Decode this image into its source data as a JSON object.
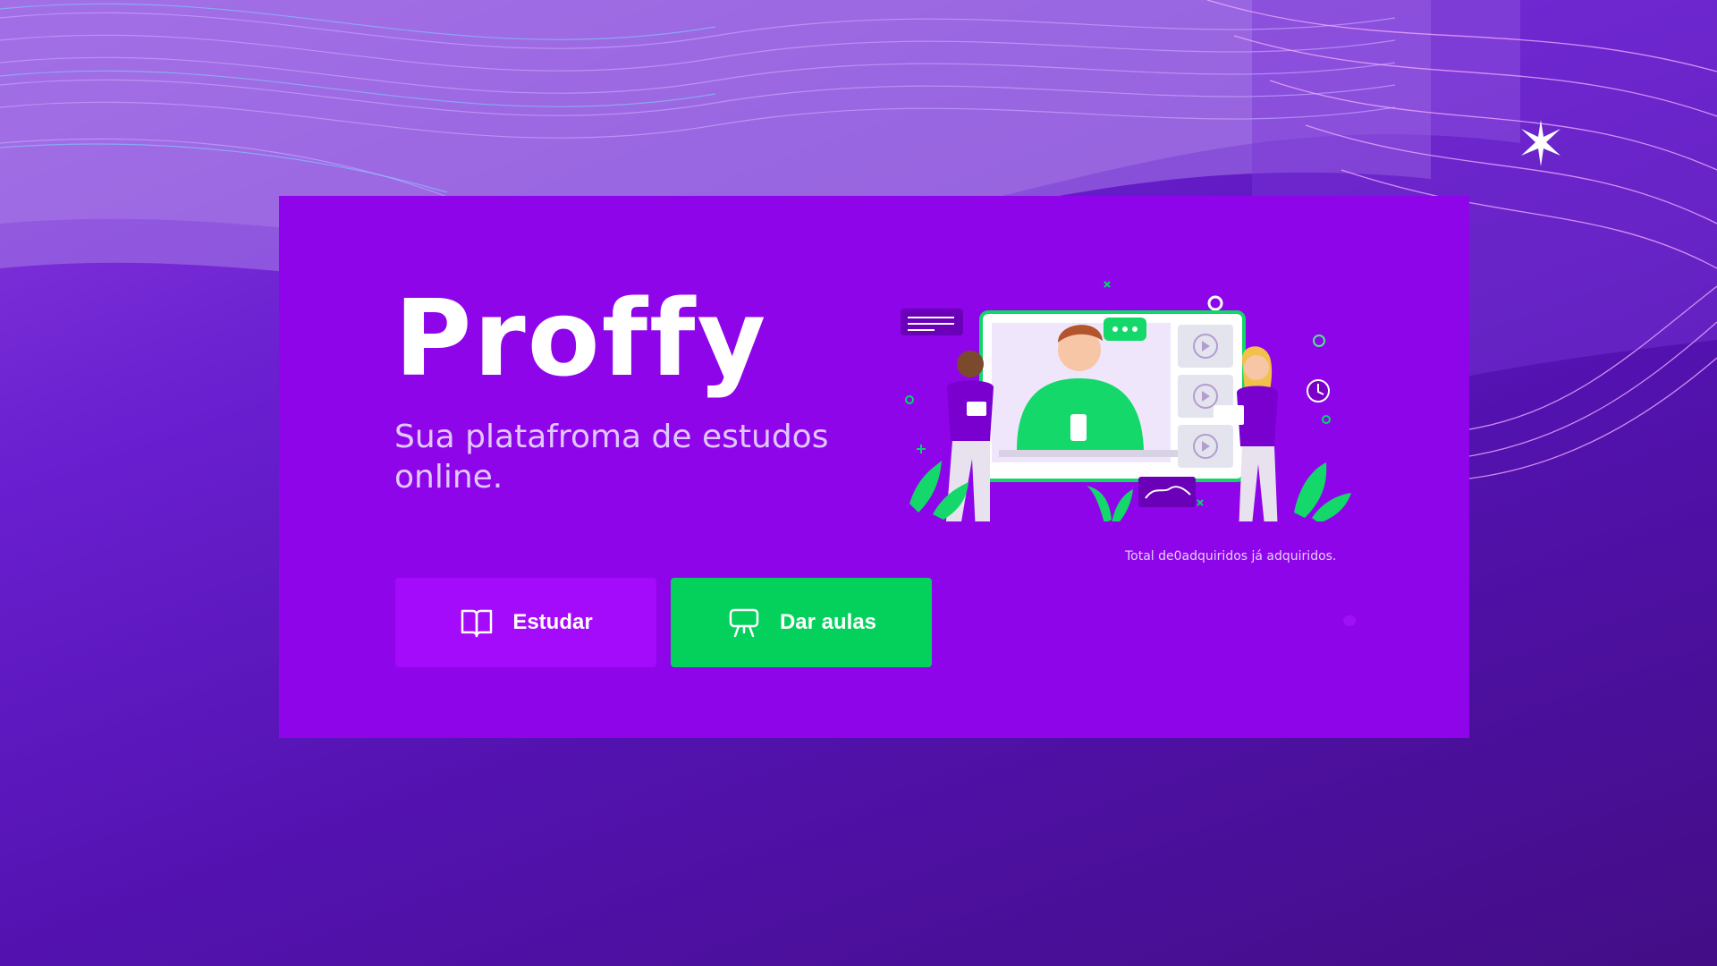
{
  "brand": {
    "name": "Proffy",
    "tagline": "Sua platafroma de estudos online."
  },
  "hero": {
    "illustration": "online-class-illustration"
  },
  "stats": {
    "total_text": "Total de0adquiridos já adquiridos."
  },
  "actions": {
    "study": {
      "label": "Estudar",
      "icon": "open-book-icon"
    },
    "teach": {
      "label": "Dar aulas",
      "icon": "presentation-board-icon"
    }
  },
  "colors": {
    "card": "#8f05ea",
    "study_button": "#a40bfa",
    "teach_button": "#03d15c",
    "text_light": "#e1c7ff"
  }
}
